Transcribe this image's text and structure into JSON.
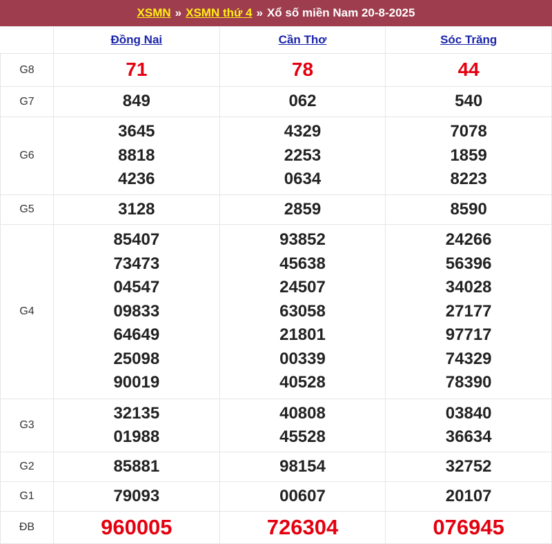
{
  "header": {
    "link1": "XSMN",
    "separator": "»",
    "link2": "XSMN thứ 4",
    "title": "Xổ số miền Nam 20-8-2025"
  },
  "provinces": [
    "Đồng Nai",
    "Cần Thơ",
    "Sóc Trăng"
  ],
  "prizes": [
    {
      "label": "G8",
      "results": [
        [
          "71"
        ],
        [
          "78"
        ],
        [
          "44"
        ]
      ]
    },
    {
      "label": "G7",
      "results": [
        [
          "849"
        ],
        [
          "062"
        ],
        [
          "540"
        ]
      ]
    },
    {
      "label": "G6",
      "results": [
        [
          "3645",
          "8818",
          "4236"
        ],
        [
          "4329",
          "2253",
          "0634"
        ],
        [
          "7078",
          "1859",
          "8223"
        ]
      ]
    },
    {
      "label": "G5",
      "results": [
        [
          "3128"
        ],
        [
          "2859"
        ],
        [
          "8590"
        ]
      ]
    },
    {
      "label": "G4",
      "results": [
        [
          "85407",
          "73473",
          "04547",
          "09833",
          "64649",
          "25098",
          "90019"
        ],
        [
          "93852",
          "45638",
          "24507",
          "63058",
          "21801",
          "00339",
          "40528"
        ],
        [
          "24266",
          "56396",
          "34028",
          "27177",
          "97717",
          "74329",
          "78390"
        ]
      ]
    },
    {
      "label": "G3",
      "results": [
        [
          "32135",
          "01988"
        ],
        [
          "40808",
          "45528"
        ],
        [
          "03840",
          "36634"
        ]
      ]
    },
    {
      "label": "G2",
      "results": [
        [
          "85881"
        ],
        [
          "98154"
        ],
        [
          "32752"
        ]
      ]
    },
    {
      "label": "G1",
      "results": [
        [
          "79093"
        ],
        [
          "00607"
        ],
        [
          "20107"
        ]
      ]
    },
    {
      "label": "ĐB",
      "results": [
        [
          "960005"
        ],
        [
          "726304"
        ],
        [
          "076945"
        ]
      ]
    }
  ],
  "colors": {
    "header_bg": "#9e3d4e",
    "header_link": "#ffef14",
    "province_link": "#1a24a8",
    "special_red": "#e4000f"
  }
}
